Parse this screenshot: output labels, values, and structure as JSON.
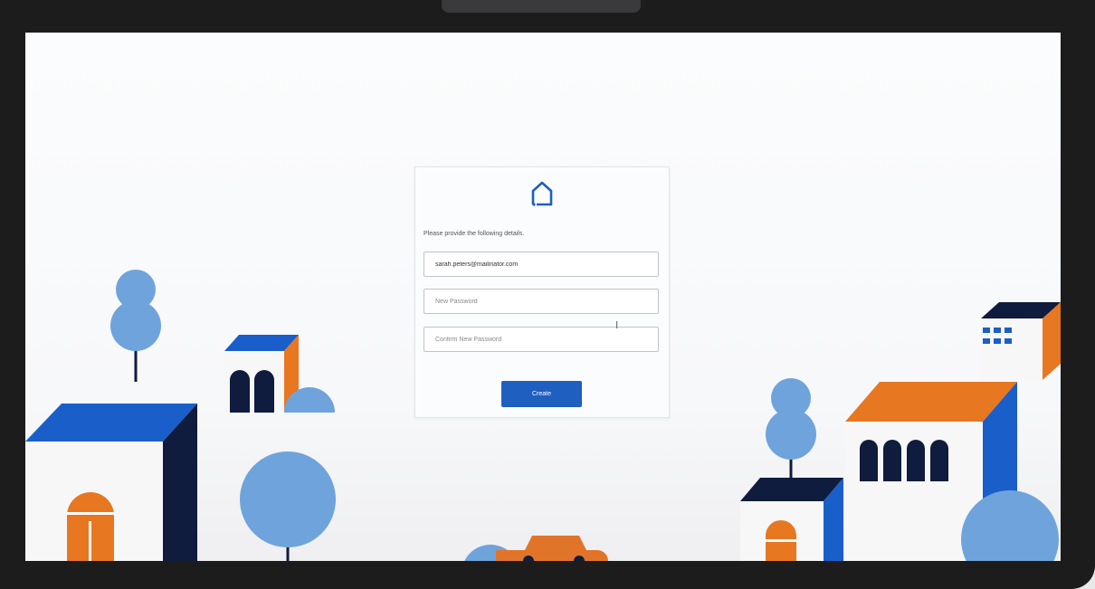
{
  "form": {
    "logo_icon": "house-outline-icon",
    "intro_text": "Please provide the following details.",
    "email_value": "sarah.peters@mailinator.com",
    "new_password_placeholder": "New Password",
    "confirm_password_placeholder": "Confirm New Password",
    "create_label": "Create"
  },
  "colors": {
    "brand_blue": "#1f5fbf",
    "illustration_orange": "#e87722",
    "illustration_navy": "#0f1c3d",
    "illustration_light_blue": "#6fa3dc"
  }
}
